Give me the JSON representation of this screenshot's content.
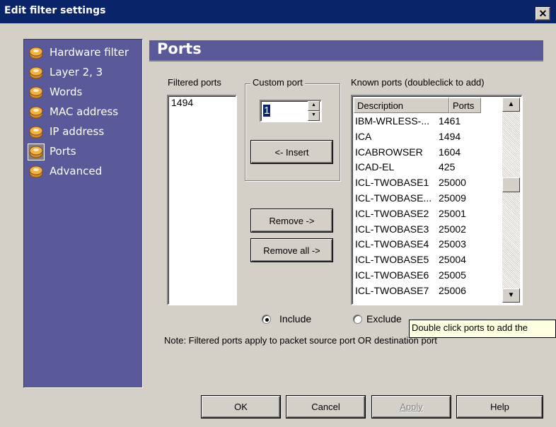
{
  "window": {
    "title": "Edit filter settings",
    "close_glyph": "✕"
  },
  "sidebar": {
    "items": [
      {
        "label": "Hardware filter",
        "icon": "filter-icon",
        "selected": false
      },
      {
        "label": "Layer 2, 3",
        "icon": "filter-icon",
        "selected": false
      },
      {
        "label": "Words",
        "icon": "filter-icon",
        "selected": false
      },
      {
        "label": "MAC address",
        "icon": "filter-icon",
        "selected": false
      },
      {
        "label": "IP address",
        "icon": "filter-icon",
        "selected": false
      },
      {
        "label": "Ports",
        "icon": "filter-icon",
        "selected": true
      },
      {
        "label": "Advanced",
        "icon": "filter-icon",
        "selected": false
      }
    ]
  },
  "panel": {
    "title": "Ports"
  },
  "filtered_ports": {
    "label": "Filtered ports",
    "items": [
      "1494"
    ]
  },
  "custom_port": {
    "label": "Custom port",
    "value": "1",
    "insert_label": "<- Insert"
  },
  "buttons": {
    "remove": "Remove ->",
    "remove_all": "Remove all ->"
  },
  "known_ports": {
    "label": "Known ports (doubleclick to add)",
    "columns": [
      "Description",
      "Ports"
    ],
    "rows": [
      [
        "IBM-WRLESS-...",
        "1461"
      ],
      [
        "ICA",
        "1494"
      ],
      [
        "ICABROWSER",
        "1604"
      ],
      [
        "ICAD-EL",
        "425"
      ],
      [
        "ICL-TWOBASE1",
        "25000"
      ],
      [
        "ICL-TWOBASE...",
        "25009"
      ],
      [
        "ICL-TWOBASE2",
        "25001"
      ],
      [
        "ICL-TWOBASE3",
        "25002"
      ],
      [
        "ICL-TWOBASE4",
        "25003"
      ],
      [
        "ICL-TWOBASE5",
        "25004"
      ],
      [
        "ICL-TWOBASE6",
        "25005"
      ],
      [
        "ICL-TWOBASE7",
        "25006"
      ]
    ]
  },
  "direction": {
    "include": "Include",
    "exclude": "Exclude",
    "selected": "include"
  },
  "note": "Note: Filtered ports apply to packet source port OR destination port",
  "tooltip": "Double click ports to add the",
  "footer": {
    "ok": "OK",
    "cancel": "Cancel",
    "apply": "Apply",
    "help": "Help"
  }
}
